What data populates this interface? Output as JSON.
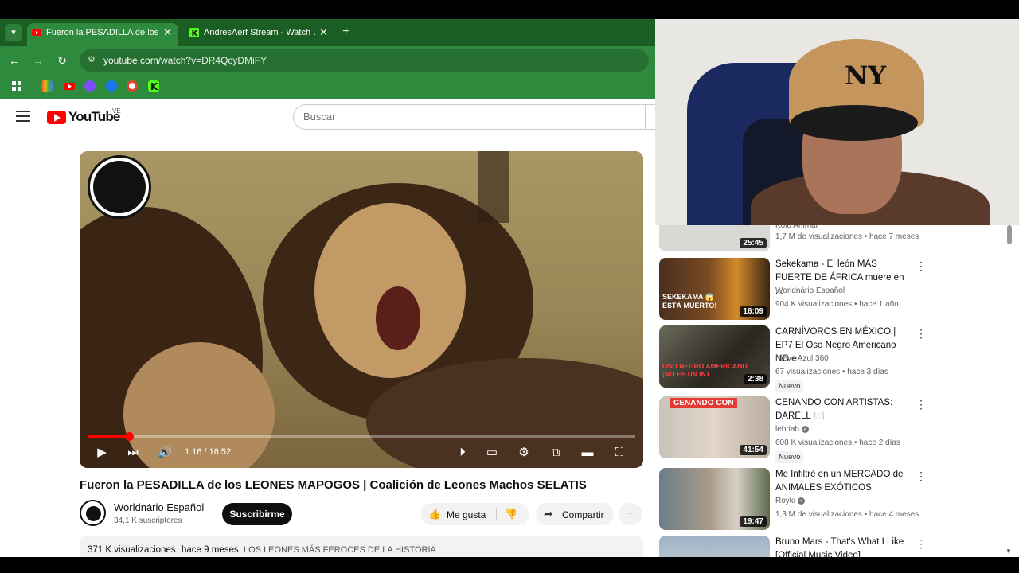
{
  "browser": {
    "tabs": [
      {
        "label": "Fueron la PESADILLA de los LEONES",
        "active": true
      },
      {
        "label": "AndresAerf Stream - Watch Live",
        "active": false
      }
    ],
    "new_tab": "+",
    "url_host": "youtube.com",
    "url_path": "/watch?v=DR4QcyDMiFY"
  },
  "youtube": {
    "logo_text": "YouTube",
    "country": "VE",
    "search_placeholder": "Buscar"
  },
  "player": {
    "timecode": "1:16 / 16:52",
    "progress_fraction": 0.075
  },
  "video": {
    "title": "Fueron la PESADILLA de los LEONES MAPOGOS | Coalición de Leones Machos SELATIS",
    "channel": "Worldnário Español",
    "subscribers": "34,1 K suscriptores",
    "subscribe_label": "Suscribirme",
    "like_label": "Me gusta",
    "share_label": "Compartir",
    "views": "371 K visualizaciones",
    "published": "hace 9 meses",
    "tag": "LOS LEONES MÁS FEROCES DE LA HISTORIA"
  },
  "sidebar": {
    "items": [
      {
        "title": "",
        "channel": "Kolo Animal",
        "stats": "1,7 M de visualizaciones • hace 7 meses",
        "duration": "25:45",
        "badge": ""
      },
      {
        "title": "Sekekama - El león MÁS FUERTE DE ÁFRICA muere en ...",
        "channel": "Worldnário Español",
        "stats": "904 K visualizaciones • hace 1 año",
        "duration": "16:09",
        "badge": "",
        "thumb_text": "SEKEKAMA 😱 ESTÁ MUERTO!"
      },
      {
        "title": "CARNÍVOROS EN MÉXICO | EP7 El Oso Negro Americano NO e...",
        "channel": "Nieve Azul 360",
        "stats": "67 visualizaciones • hace 3 días",
        "duration": "2:38",
        "badge": "Nuevo",
        "thumb_text": "OSO NEGRO AMERICANO ¡NO ES UN INT"
      },
      {
        "title": "CENANDO CON ARTISTAS: DARELL 🍽️",
        "channel": "lebriah",
        "stats": "608 K visualizaciones • hace 2 días",
        "duration": "41:54",
        "badge": "Nuevo",
        "thumb_text": "CENANDO CON"
      },
      {
        "title": "Me Infiltré en un MERCADO de ANIMALES EXÓTICOS",
        "channel": "Royki",
        "stats": "1,3 M de visualizaciones • hace 4 meses",
        "duration": "19:47",
        "badge": ""
      },
      {
        "title": "Bruno Mars - That's What I Like [Official Music Video]",
        "channel": "",
        "stats": "",
        "duration": "",
        "badge": ""
      }
    ]
  },
  "webcam": {
    "cap_logo": "NY"
  }
}
